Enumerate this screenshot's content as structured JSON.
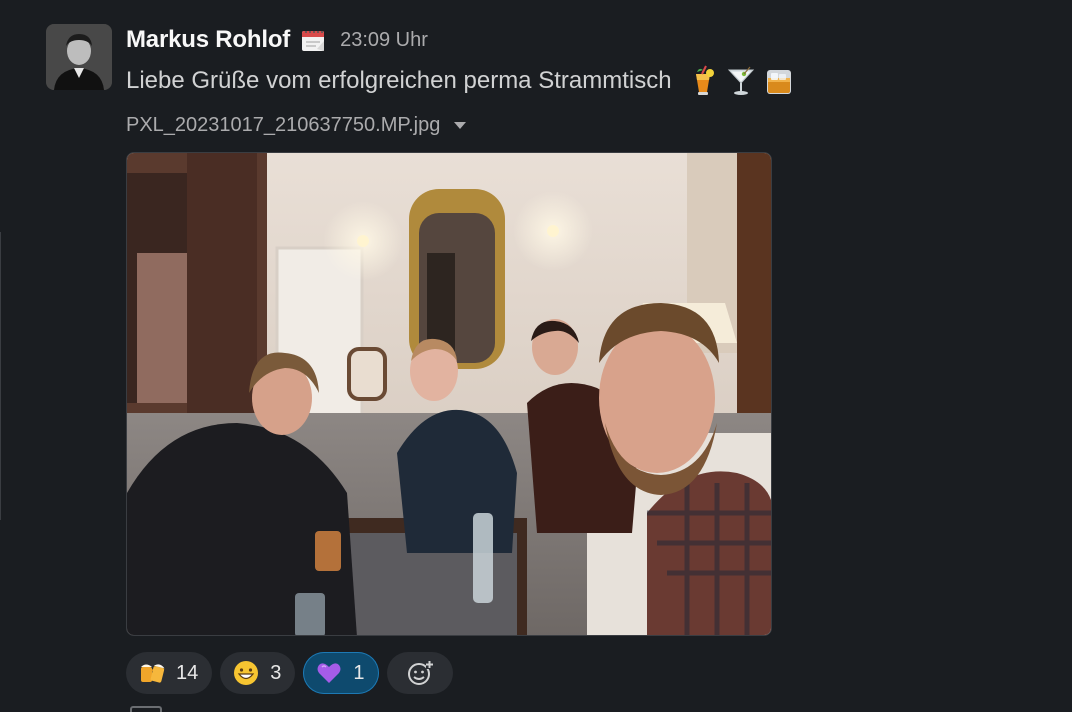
{
  "message": {
    "sender": "Markus Rohlof",
    "status_icon": "calendar-icon",
    "timestamp": "23:09 Uhr",
    "text": "Liebe Grüße vom erfolgreichen perma Strammtisch",
    "text_emojis": [
      "tropical-drink-icon",
      "cocktail-glass-icon",
      "tumbler-glass-icon"
    ],
    "attachment": {
      "file_name": "PXL_20231017_210637750.MP.jpg",
      "menu_icon": "caret-down-icon"
    }
  },
  "reactions": [
    {
      "icon": "beers-icon",
      "count": "14",
      "active": false
    },
    {
      "icon": "grinning-face-icon",
      "count": "3",
      "active": false
    },
    {
      "icon": "purple-heart-icon",
      "count": "1",
      "active": true
    }
  ],
  "add_reaction_icon": "add-reaction-icon",
  "colors": {
    "background": "#1a1d21",
    "reaction_bg": "#2b2e33",
    "reaction_active_bg": "#0e4a6e",
    "reaction_active_border": "#1d79b4"
  }
}
